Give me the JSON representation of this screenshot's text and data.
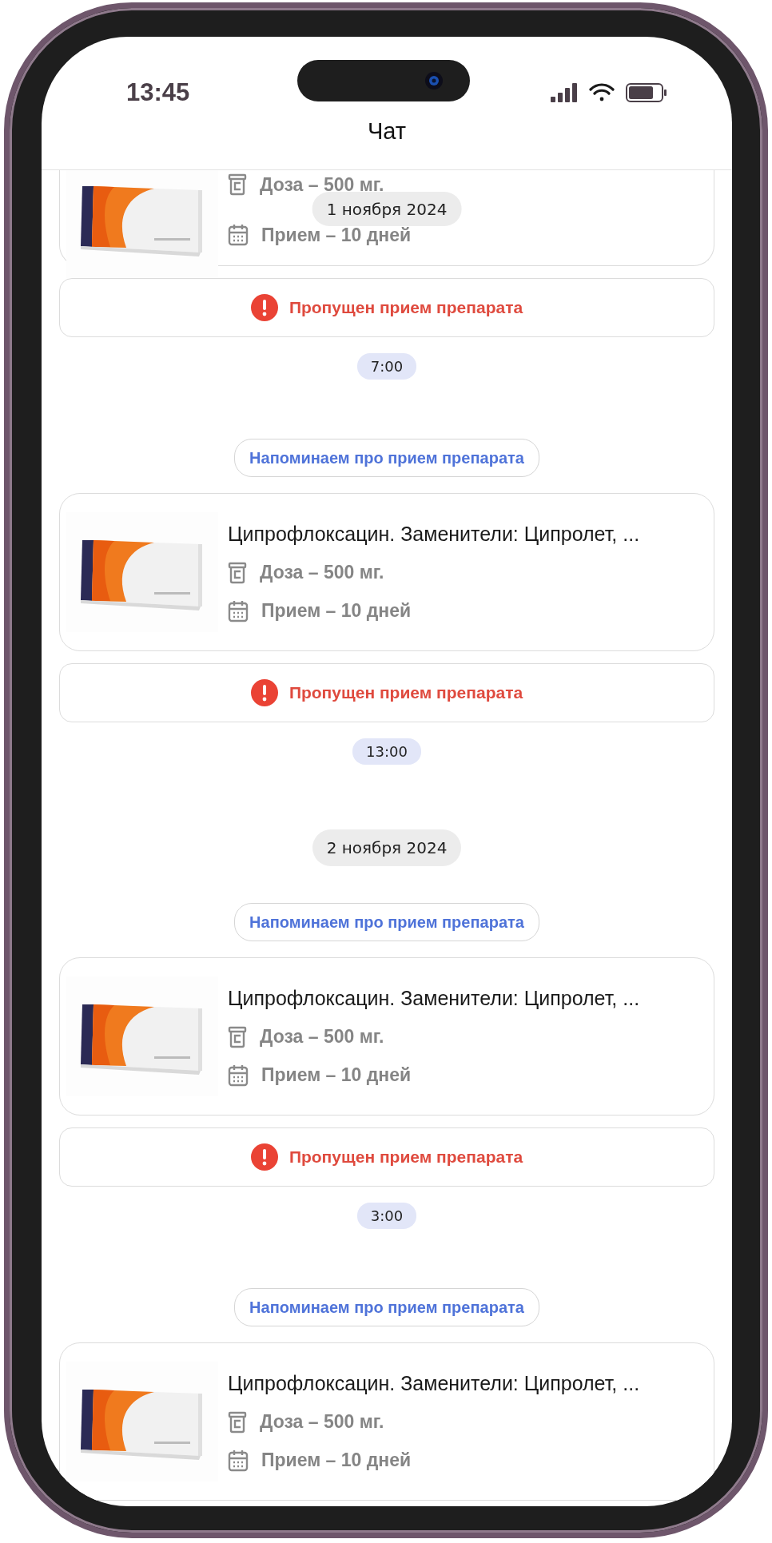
{
  "status_bar": {
    "time": "13:45"
  },
  "header": {
    "title": "Чат"
  },
  "sticky_date": "1 ноября 2024",
  "messages": [
    {
      "kind": "med_card",
      "dose": "Доза – 500 мг.",
      "course": "Прием – 10 дней"
    },
    {
      "kind": "missed",
      "text": "Пропущен прием препарата"
    },
    {
      "kind": "time",
      "text": "7:00"
    },
    {
      "kind": "reminder",
      "text": "Напоминаем про прием препарата"
    },
    {
      "kind": "med_card",
      "title": "Ципрофлоксацин. Заменители: Ципролет, ...",
      "dose": "Доза – 500 мг.",
      "course": "Прием – 10 дней"
    },
    {
      "kind": "missed",
      "text": "Пропущен прием препарата"
    },
    {
      "kind": "time",
      "text": "13:00"
    },
    {
      "kind": "date",
      "text": "2 ноября 2024"
    },
    {
      "kind": "reminder",
      "text": "Напоминаем про прием препарата"
    },
    {
      "kind": "med_card",
      "title": "Ципрофлоксацин. Заменители: Ципролет, ...",
      "dose": "Доза – 500 мг.",
      "course": "Прием – 10 дней"
    },
    {
      "kind": "missed",
      "text": "Пропущен прием препарата"
    },
    {
      "kind": "time",
      "text": "3:00"
    },
    {
      "kind": "reminder",
      "text": "Напоминаем про прием препарата"
    },
    {
      "kind": "med_card",
      "title": "Ципрофлоксацин. Заменители: Ципролет, ...",
      "dose": "Доза – 500 мг.",
      "course": "Прием – 10 дней"
    }
  ]
}
